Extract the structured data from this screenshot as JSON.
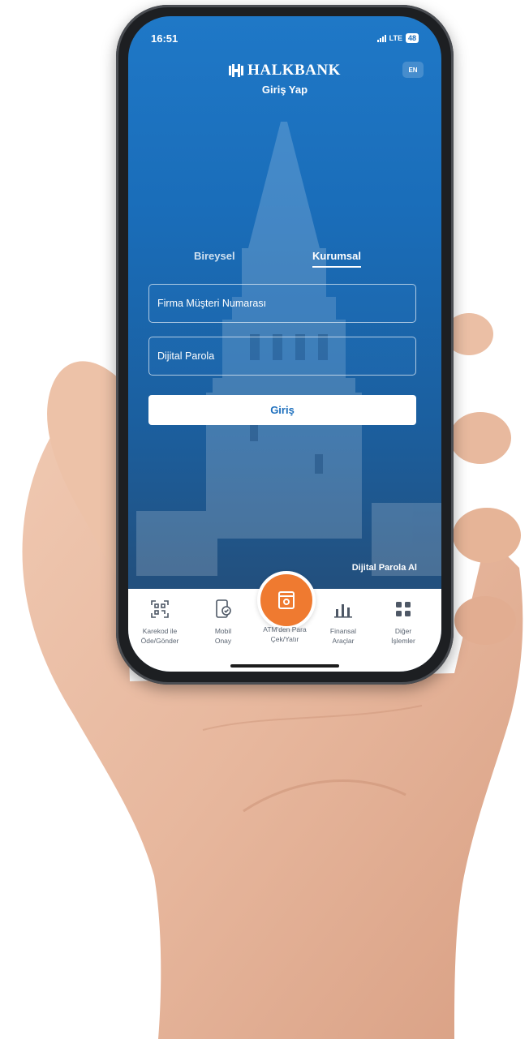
{
  "status": {
    "time": "16:51",
    "network": "LTE",
    "battery": "48"
  },
  "header": {
    "brand": "HALKBANK",
    "subtitle": "Giriş Yap",
    "lang": "EN"
  },
  "tabs": [
    {
      "label": "Bireysel"
    },
    {
      "label": "Kurumsal",
      "active": true
    }
  ],
  "form": {
    "customer_placeholder": "Firma Müşteri Numarası",
    "password_placeholder": "Dijital Parola",
    "login_label": "Giriş"
  },
  "links": {
    "digital_password": "Dijital Parola Al"
  },
  "bottom_nav": [
    {
      "label_1": "Karekod ile",
      "label_2": "Öde/Gönder",
      "icon": "qr-code-icon"
    },
    {
      "label_1": "Mobil",
      "label_2": "Onay",
      "icon": "mobile-approve-icon"
    },
    {
      "label_1": "ATM'den Para",
      "label_2": "Çek/Yatır",
      "icon": "atm-icon"
    },
    {
      "label_1": "Finansal",
      "label_2": "Araçlar",
      "icon": "bar-chart-icon"
    },
    {
      "label_1": "Diğer",
      "label_2": "İşlemler",
      "icon": "grid-icon"
    }
  ],
  "colors": {
    "primary_blue": "#1d6fbd",
    "accent_orange": "#ef7a30",
    "white": "#ffffff"
  }
}
